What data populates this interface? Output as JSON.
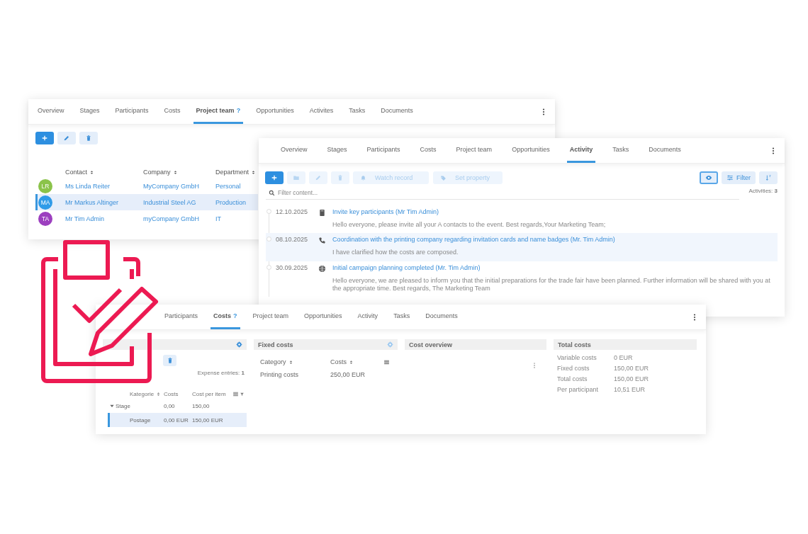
{
  "team_window": {
    "tabs": [
      {
        "label": "Overview",
        "selected": false
      },
      {
        "label": "Stages",
        "selected": false
      },
      {
        "label": "Participants",
        "selected": false
      },
      {
        "label": "Costs",
        "selected": false
      },
      {
        "label": "Project team",
        "help": "?",
        "selected": true
      },
      {
        "label": "Opportunities",
        "selected": false
      },
      {
        "label": "Activites",
        "selected": false
      },
      {
        "label": "Tasks",
        "selected": false
      },
      {
        "label": "Documents",
        "selected": false
      }
    ],
    "table": {
      "columns": [
        "Contact",
        "Company",
        "Department"
      ],
      "rows": [
        {
          "initials": "LR",
          "color": "#8bc34a",
          "contact": "Ms Linda Reiter",
          "company": "MyCompany GmbH",
          "department": "Personal",
          "selected": false
        },
        {
          "initials": "MA",
          "color": "#2f9be8",
          "contact": "Mr Markus Altinger",
          "company": "Industrial Steel AG",
          "department": "Production",
          "selected": true
        },
        {
          "initials": "TA",
          "color": "#9c3fbf",
          "contact": "Mr Tim Admin",
          "company": "myCompany GmbH",
          "department": "IT",
          "selected": false
        }
      ]
    }
  },
  "activity_window": {
    "tabs": [
      {
        "label": "Overview",
        "selected": false
      },
      {
        "label": "Stages",
        "selected": false
      },
      {
        "label": "Participants",
        "selected": false
      },
      {
        "label": "Costs",
        "selected": false
      },
      {
        "label": "Project team",
        "selected": false
      },
      {
        "label": "Opportunities",
        "selected": false
      },
      {
        "label": "Activity",
        "selected": true
      },
      {
        "label": "Tasks",
        "selected": false
      },
      {
        "label": "Documents",
        "selected": false
      }
    ],
    "toolbar": {
      "watch_record": {
        "label": "Watch record",
        "disabled": true
      },
      "set_property": {
        "label": "Set property",
        "disabled": true
      },
      "view_toggle": {
        "on": true
      },
      "filter": {
        "label": "Filter"
      }
    },
    "search": {
      "placeholder": "Filter content..."
    },
    "count": "Activities: **3**",
    "activities": [
      {
        "date": "12.10.2025",
        "kind": "note",
        "title": "Invite key participants (Mr Tim Admin)",
        "text": "Hello everyone, please invite all your A contacts to the event. Best regards,Your Marketing Team;",
        "selected": false
      },
      {
        "date": "08.10.2025",
        "kind": "call",
        "title": "Coordination with the printing company regarding invitation cards and name badges (Mr. Tim Admin)",
        "text": "I have clarified how the costs are composed.",
        "selected": true
      },
      {
        "date": "30.09.2025",
        "kind": "web",
        "title": "Initial campaign planning completed (Mr. Tim Admin)",
        "text": "Hello everyone, we are pleased to inform you that the initial preparations for the trade fair have been planned. Further information will be shared with you at the appropriate time. Best regards, The Marketing Team",
        "selected": false
      }
    ]
  },
  "costs_window": {
    "tabs": [
      {
        "label": "Participants",
        "selected": false
      },
      {
        "label": "Costs",
        "help": "?",
        "selected": true
      },
      {
        "label": "Project team",
        "selected": false
      },
      {
        "label": "Opportunities",
        "selected": false
      },
      {
        "label": "Activity",
        "selected": false
      },
      {
        "label": "Tasks",
        "selected": false
      },
      {
        "label": "Documents",
        "selected": false
      }
    ],
    "variable_panel": {
      "expense_entries": "Expense entries: **1**",
      "columns": [
        "Kategorie",
        "Costs",
        "Cost per item"
      ],
      "rows": [
        {
          "category": "Stage",
          "costs": "0,00",
          "cost_per_item": "150,00",
          "expanded": true,
          "children": [
            {
              "category": "Postage",
              "costs": "0,00 EUR",
              "cost_per_item": "150,00 EUR",
              "selected": true
            }
          ]
        }
      ]
    },
    "fixed_panel": {
      "title": "Fixed costs",
      "columns": [
        "Category",
        "Costs"
      ],
      "rows": [
        {
          "category": "Printing costs",
          "costs": "250,00 EUR"
        }
      ]
    },
    "overview_panel": {
      "title": "Cost overview"
    },
    "totals_panel": {
      "title": "Total costs",
      "rows": [
        {
          "label": "Variable costs",
          "value": "0 EUR"
        },
        {
          "label": "Fixed costs",
          "value": "150,00 EUR"
        },
        {
          "label": "Total costs",
          "value": "150,00 EUR"
        },
        {
          "label": "Per participant",
          "value": "10,51 EUR"
        }
      ]
    }
  }
}
